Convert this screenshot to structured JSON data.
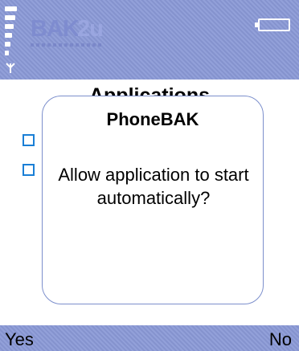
{
  "header": {
    "logo": {
      "part_a": "BAK",
      "part_b": "2u"
    },
    "signal_level": 5,
    "battery_icon": "battery-icon",
    "antenna_icon": "antenna-icon"
  },
  "page": {
    "heading": "Applications"
  },
  "dialog": {
    "title": "PhoneBAK",
    "message": "Allow application to start automatically?"
  },
  "softkeys": {
    "left": "Yes",
    "right": "No"
  },
  "colors": {
    "bar_background": "#8a99d6",
    "dialog_border": "#7c8fcc",
    "checkbox_border": "#1a7fd6"
  }
}
